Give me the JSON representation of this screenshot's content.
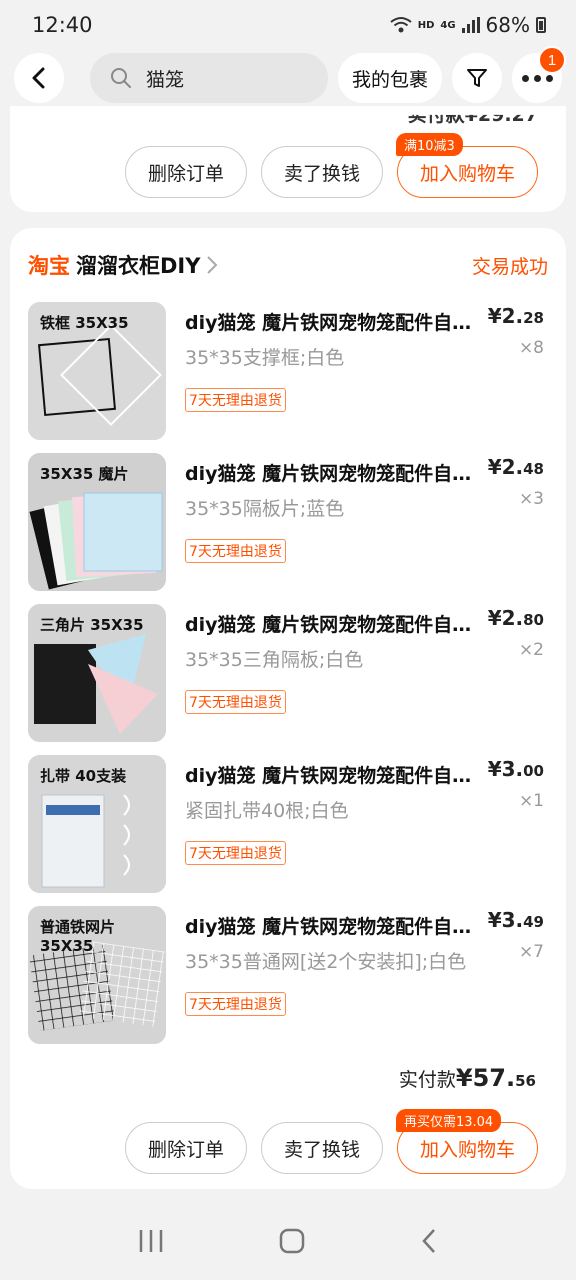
{
  "status": {
    "time": "12:40",
    "hd": "HD",
    "net": "4G",
    "battery": "68%"
  },
  "search": {
    "query": "猫笼"
  },
  "toolbar": {
    "my_packages": "我的包裹",
    "more_badge": "1"
  },
  "prev_order": {
    "clipped_text": "实付款¥29.27",
    "buttons": {
      "delete": "删除订单",
      "resell": "卖了换钱",
      "add_cart": "加入购物车"
    },
    "promo": "满10减3"
  },
  "order": {
    "platform": "淘宝",
    "shop_name": "溜溜衣柜DIY",
    "status": "交易成功",
    "return_policy": "7天无理由退货",
    "items": [
      {
        "thumb_label": "铁框 35X35",
        "title": "diy猫笼 魔片铁网宠物笼配件自…",
        "spec": "35*35支撑框;白色",
        "price_int": "¥2.",
        "price_dec": "28",
        "qty": "×8"
      },
      {
        "thumb_label": "35X35 魔片",
        "title": "diy猫笼 魔片铁网宠物笼配件自…",
        "spec": "35*35隔板片;蓝色",
        "price_int": "¥2.",
        "price_dec": "48",
        "qty": "×3"
      },
      {
        "thumb_label": "三角片 35X35",
        "title": "diy猫笼 魔片铁网宠物笼配件自…",
        "spec": "35*35三角隔板;白色",
        "price_int": "¥2.",
        "price_dec": "80",
        "qty": "×2"
      },
      {
        "thumb_label": "扎带 40支装",
        "title": "diy猫笼 魔片铁网宠物笼配件自…",
        "spec": "紧固扎带40根;白色",
        "price_int": "¥3.",
        "price_dec": "00",
        "qty": "×1"
      },
      {
        "thumb_label": "普通铁网片 35X35",
        "title": "diy猫笼 魔片铁网宠物笼配件自…",
        "spec": "35*35普通网[送2个安装扣];白色",
        "price_int": "¥3.",
        "price_dec": "49",
        "qty": "×7"
      }
    ],
    "total_label": "实付款",
    "total_int": "¥57.",
    "total_dec": "56",
    "buttons": {
      "delete": "删除订单",
      "resell": "卖了换钱",
      "add_cart": "加入购物车"
    },
    "promo": "再买仅需13.04"
  },
  "colors": {
    "accent": "#ff5000"
  },
  "icons": [
    "back-arrow-icon",
    "search-icon",
    "filter-icon",
    "more-icon",
    "chevron-right-icon",
    "nav-recents-icon",
    "nav-home-icon",
    "nav-back-icon"
  ]
}
